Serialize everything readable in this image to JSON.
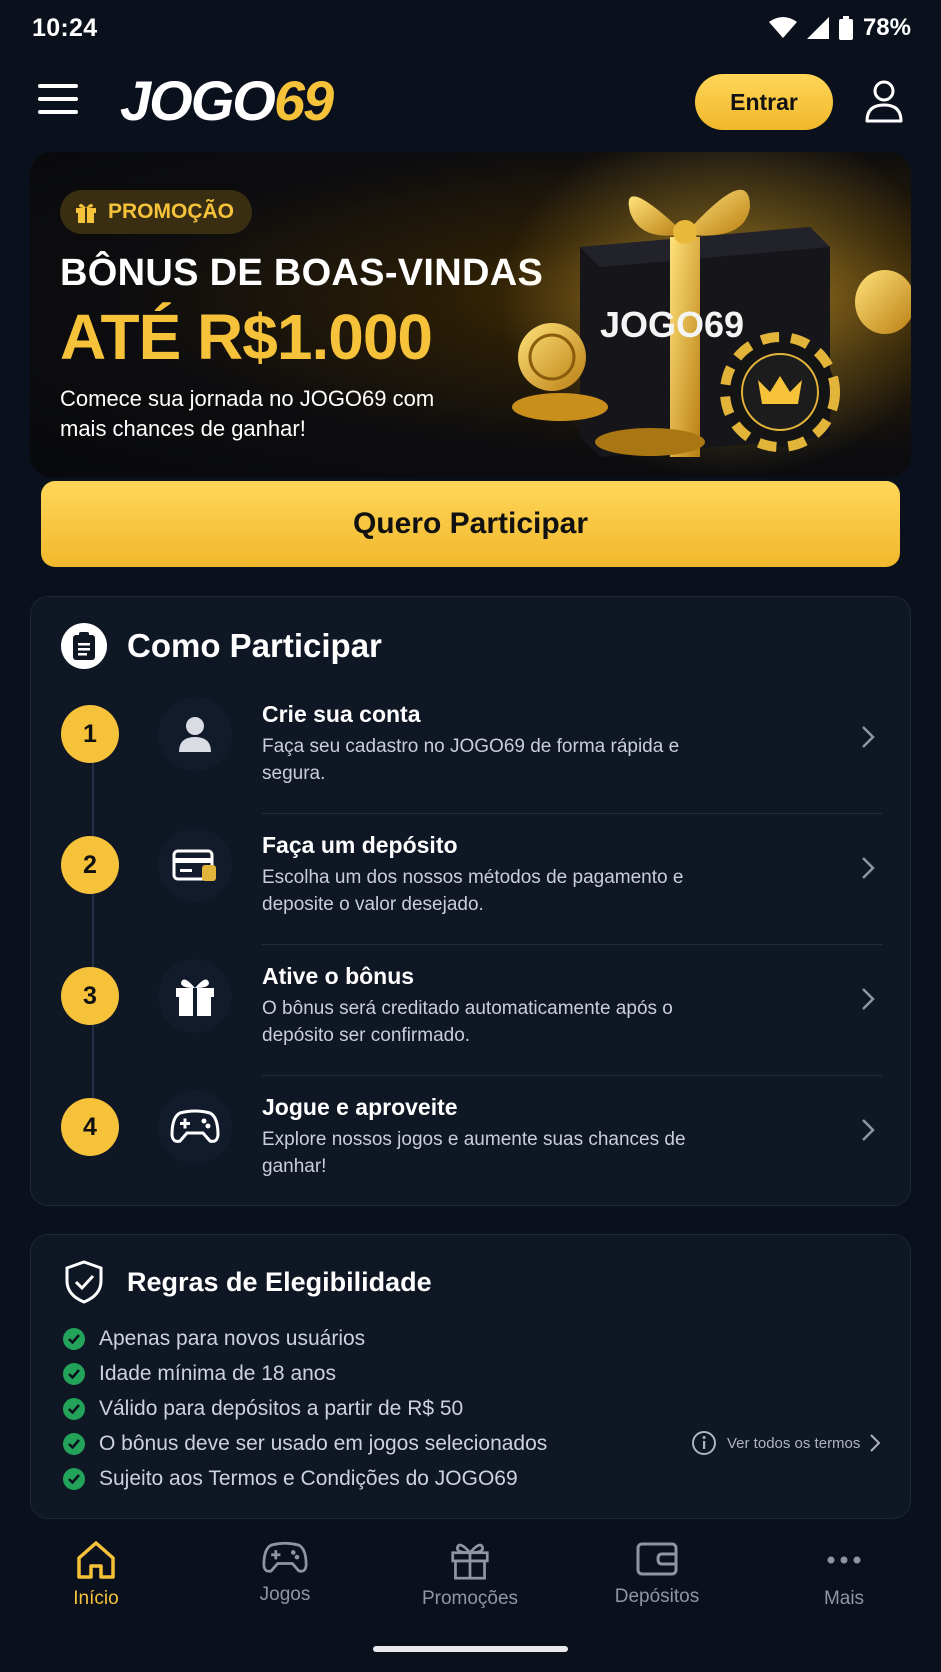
{
  "status_bar": {
    "time": "10:24",
    "battery": "78%"
  },
  "header": {
    "logo_main": "JOGO",
    "logo_accent": "69",
    "login_label": "Entrar"
  },
  "promo": {
    "badge": "PROMOÇÃO",
    "title": "BÔNUS DE BOAS-VINDAS",
    "amount": "ATÉ R$1.000",
    "subtitle": "Comece sua jornada no JOGO69 com mais chances de ganhar!",
    "box_logo": "JOGO69",
    "cta_label": "Quero Participar"
  },
  "how_to": {
    "title": "Como Participar",
    "steps": [
      {
        "number": "1",
        "title": "Crie sua conta",
        "description": "Faça seu cadastro no JOGO69 de forma rápida e segura."
      },
      {
        "number": "2",
        "title": "Faça um depósito",
        "description": "Escolha um dos nossos métodos de pagamento e deposite o valor desejado."
      },
      {
        "number": "3",
        "title": "Ative o bônus",
        "description": "O bônus será creditado automaticamente após o depósito ser confirmado."
      },
      {
        "number": "4",
        "title": "Jogue e aproveite",
        "description": "Explore nossos jogos e aumente suas chances de ganhar!"
      }
    ]
  },
  "rules": {
    "title": "Regras de Elegibilidade",
    "items": [
      "Apenas para novos usuários",
      "Idade mínima de 18 anos",
      "Válido para depósitos a partir de R$ 50",
      "O bônus deve ser usado em jogos selecionados",
      "Sujeito aos Termos e Condições do JOGO69"
    ],
    "terms_link": "Ver todos os termos"
  },
  "bottom_nav": {
    "items": [
      {
        "label": "Início",
        "icon": "home-icon",
        "active": true
      },
      {
        "label": "Jogos",
        "icon": "gamepad-icon",
        "active": false
      },
      {
        "label": "Promoções",
        "icon": "gift-icon",
        "active": false
      },
      {
        "label": "Depósitos",
        "icon": "wallet-icon",
        "active": false
      },
      {
        "label": "Mais",
        "icon": "more-icon",
        "active": false
      }
    ]
  },
  "colors": {
    "accent": "#f6c23a",
    "background": "#0b111c",
    "card": "#0f1624",
    "success": "#23a35a"
  }
}
